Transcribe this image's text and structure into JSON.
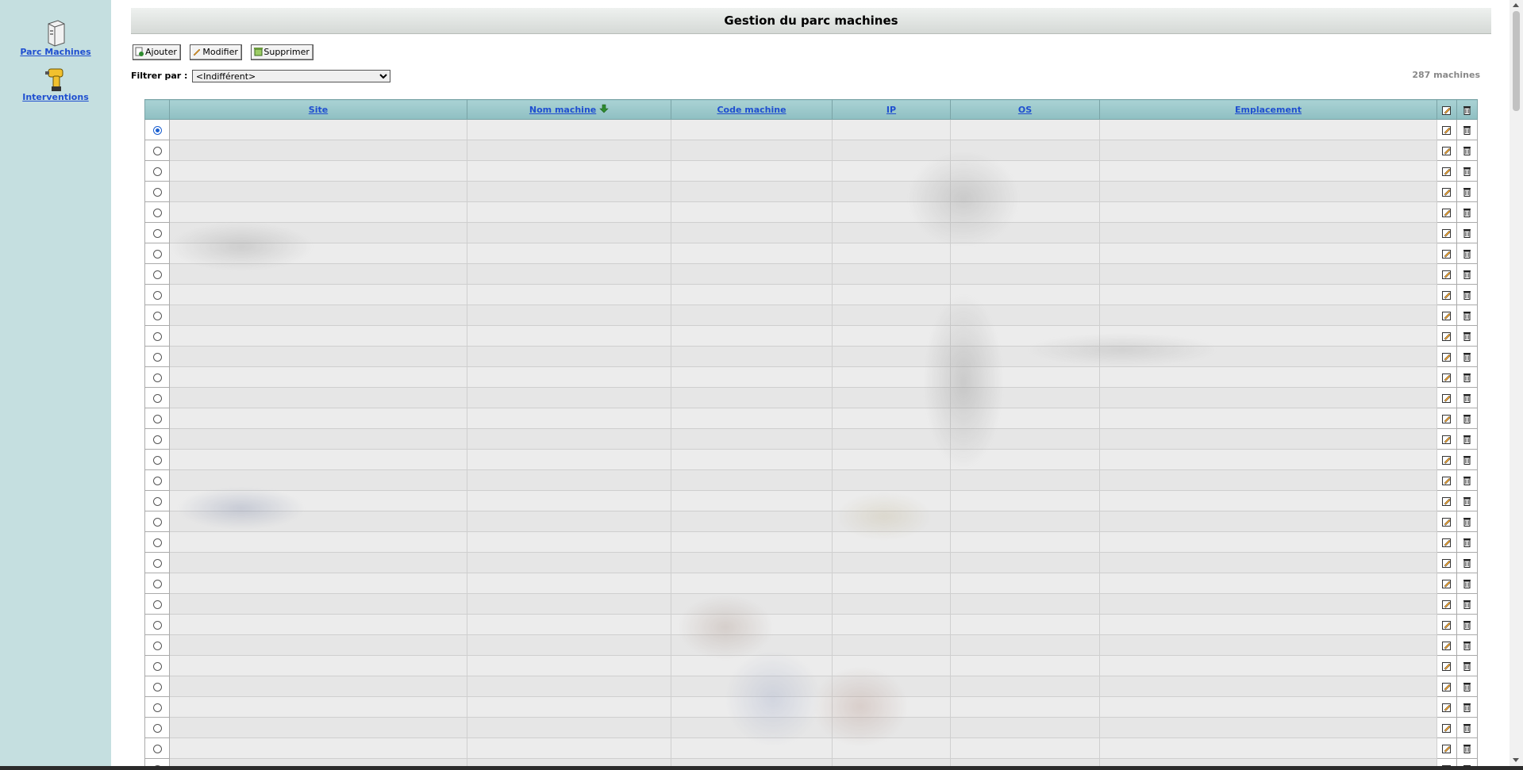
{
  "sidebar": {
    "items": [
      {
        "label": "Parc Machines",
        "icon": "computer-tower-icon"
      },
      {
        "label": "Interventions",
        "icon": "drill-icon"
      }
    ]
  },
  "header": {
    "title": "Gestion du parc machines"
  },
  "toolbar": {
    "add_label": "Ajouter",
    "edit_label": "Modifier",
    "delete_label": "Supprimer"
  },
  "filter": {
    "label": "Filtrer par :",
    "selected": "<Indifférent>"
  },
  "count_label": "287 machines",
  "table": {
    "columns": [
      {
        "label": "Site"
      },
      {
        "label": "Nom machine",
        "sorted": "descending"
      },
      {
        "label": "Code machine"
      },
      {
        "label": "IP"
      },
      {
        "label": "OS"
      },
      {
        "label": "Emplacement"
      }
    ],
    "selected_row_index": 0
  },
  "colors": {
    "sidebar_bg": "#c5dfe0",
    "header_bg": "#9fc9cc",
    "link": "#1f4fd0",
    "sort_arrow": "#2e8b2e"
  }
}
